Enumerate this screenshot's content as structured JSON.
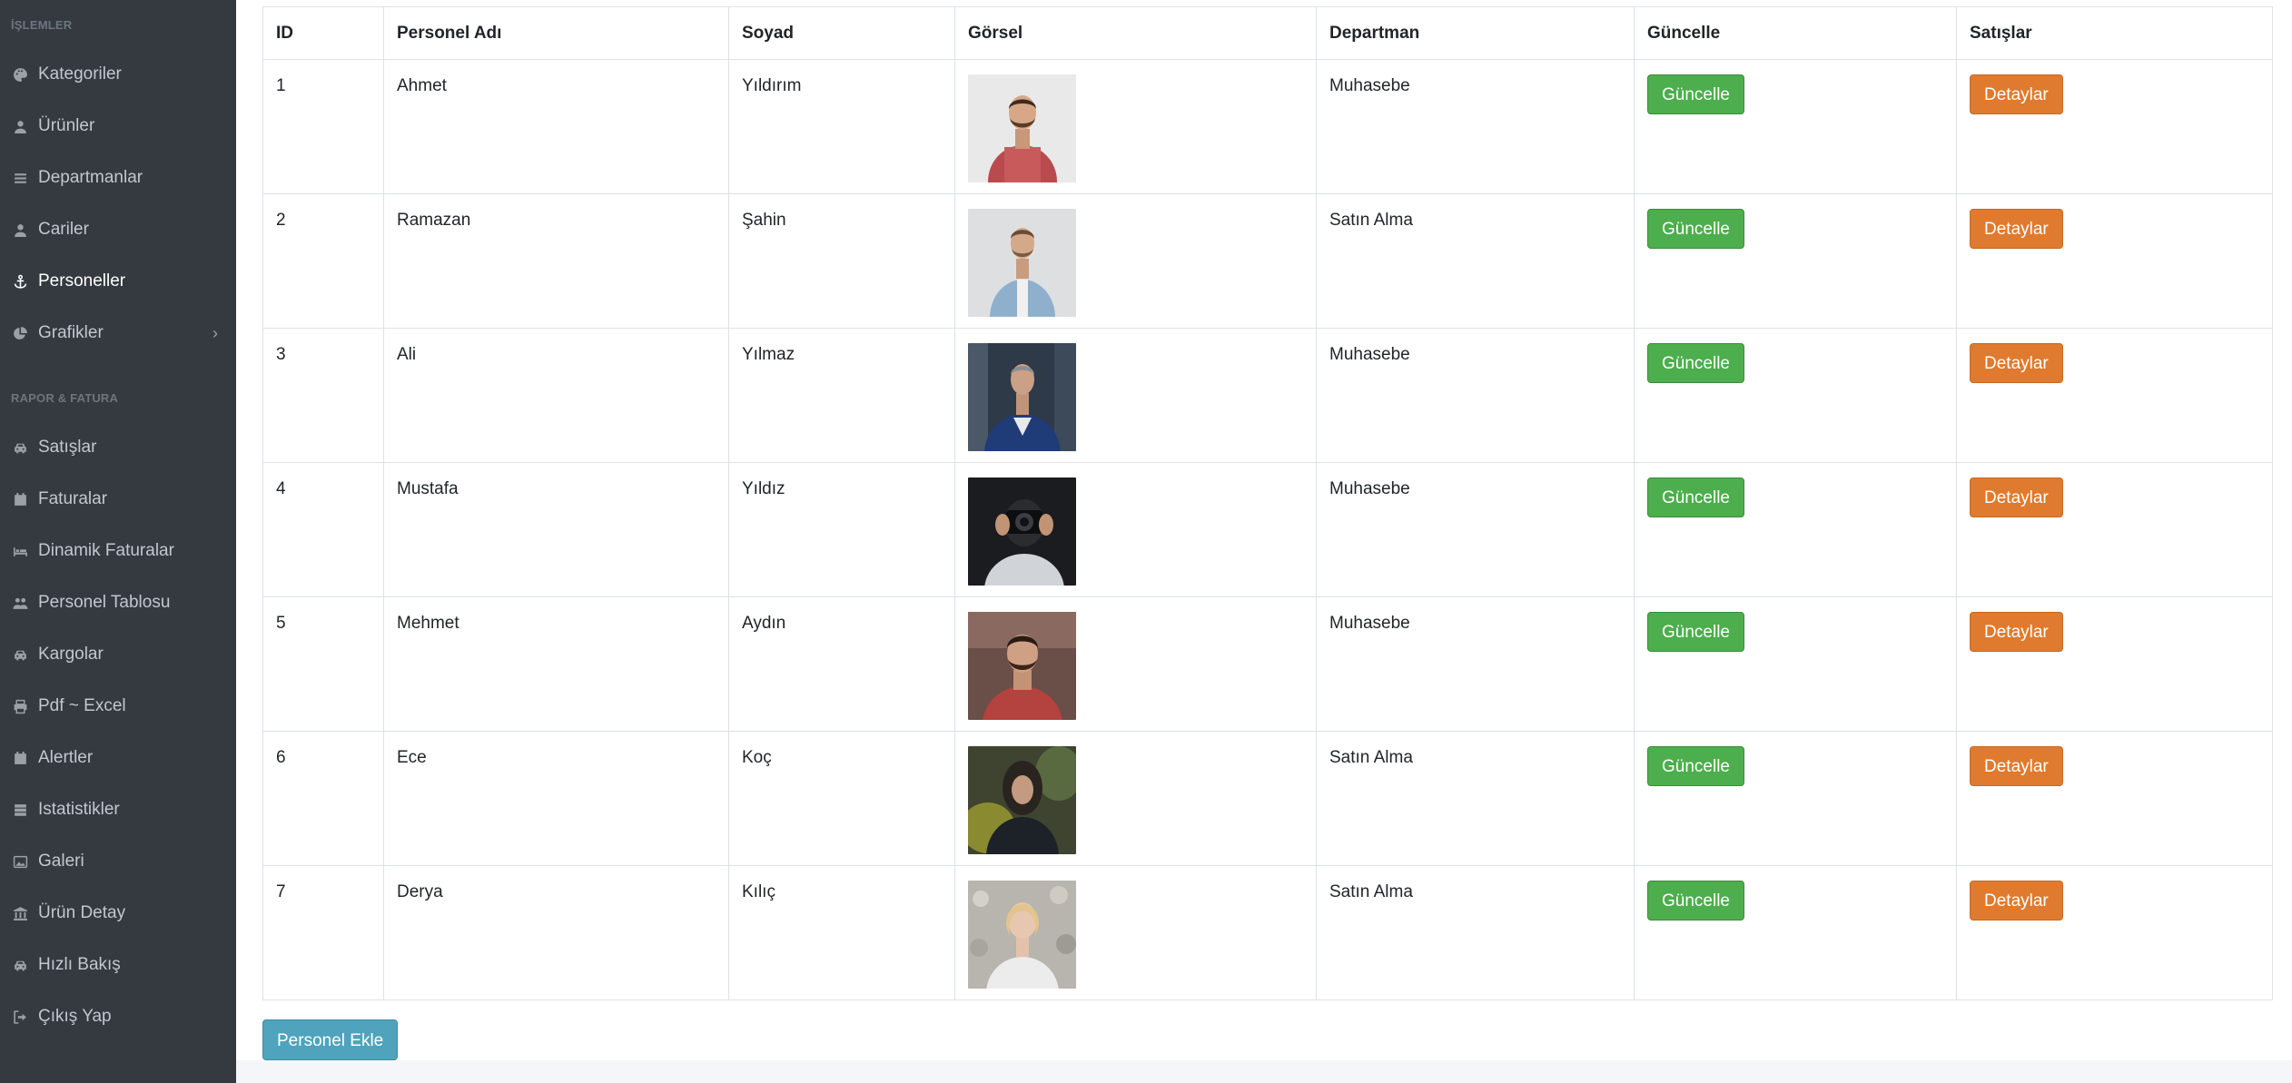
{
  "sidebar": {
    "section_islemler": "İŞLEMLER",
    "section_rapor": "RAPOR & FATURA",
    "items": [
      {
        "label": "Kategoriler",
        "icon": "palette-icon"
      },
      {
        "label": "Ürünler",
        "icon": "user-icon"
      },
      {
        "label": "Departmanlar",
        "icon": "list-icon"
      },
      {
        "label": "Cariler",
        "icon": "user-icon"
      },
      {
        "label": "Personeller",
        "icon": "anchor-icon",
        "active": true
      },
      {
        "label": "Grafikler",
        "icon": "pie-chart-icon",
        "has_arrow": true
      },
      {
        "label": "Satışlar",
        "icon": "car-icon"
      },
      {
        "label": "Faturalar",
        "icon": "calendar-icon"
      },
      {
        "label": "Dinamik Faturalar",
        "icon": "bed-icon"
      },
      {
        "label": "Personel Tablosu",
        "icon": "people-icon"
      },
      {
        "label": "Kargolar",
        "icon": "car-icon"
      },
      {
        "label": "Pdf ~ Excel",
        "icon": "print-icon"
      },
      {
        "label": "Alertler",
        "icon": "calendar-icon"
      },
      {
        "label": "Istatistikler",
        "icon": "server-icon"
      },
      {
        "label": "Galeri",
        "icon": "image-icon"
      },
      {
        "label": "Ürün Detay",
        "icon": "bank-icon"
      },
      {
        "label": "Hızlı Bakış",
        "icon": "car-icon"
      },
      {
        "label": "Çıkış Yap",
        "icon": "sign-out-icon"
      }
    ]
  },
  "table": {
    "headers": [
      "ID",
      "Personel Adı",
      "Soyad",
      "Görsel",
      "Departman",
      "Güncelle",
      "Satışlar"
    ],
    "rows": [
      {
        "id": "1",
        "name": "Ahmet",
        "surname": "Yıldırım",
        "department": "Muhasebe"
      },
      {
        "id": "2",
        "name": "Ramazan",
        "surname": "Şahin",
        "department": "Satın Alma"
      },
      {
        "id": "3",
        "name": "Ali",
        "surname": "Yılmaz",
        "department": "Muhasebe"
      },
      {
        "id": "4",
        "name": "Mustafa",
        "surname": "Yıldız",
        "department": "Muhasebe"
      },
      {
        "id": "5",
        "name": "Mehmet",
        "surname": "Aydın",
        "department": "Muhasebe"
      },
      {
        "id": "6",
        "name": "Ece",
        "surname": "Koç",
        "department": "Satın Alma"
      },
      {
        "id": "7",
        "name": "Derya",
        "surname": "Kılıç",
        "department": "Satın Alma"
      }
    ],
    "update_label": "Güncelle",
    "details_label": "Detaylar"
  },
  "add_button_label": "Personel Ekle",
  "colors": {
    "sidebar_bg": "#343a40",
    "success": "#4cae4c",
    "warning": "#e07a2e",
    "info": "#4fa3bc"
  }
}
